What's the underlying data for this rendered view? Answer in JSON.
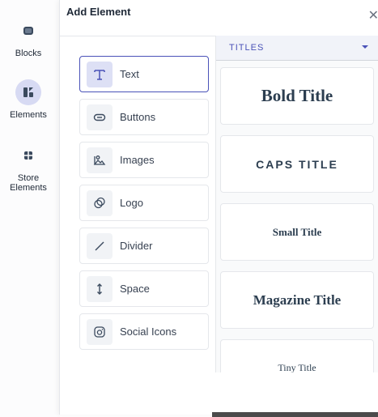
{
  "rail": {
    "items": [
      {
        "label": "Blocks",
        "icon": "blocks-icon"
      },
      {
        "label": "Elements",
        "icon": "elements-icon",
        "active": true
      },
      {
        "label": "Store Elements",
        "icon": "store-elements-icon"
      }
    ]
  },
  "panel": {
    "title": "Add Element",
    "close": "✕"
  },
  "elements": [
    {
      "label": "Text",
      "icon": "text-icon"
    },
    {
      "label": "Buttons",
      "icon": "buttons-icon"
    },
    {
      "label": "Images",
      "icon": "images-icon"
    },
    {
      "label": "Logo",
      "icon": "logo-icon"
    },
    {
      "label": "Divider",
      "icon": "divider-icon"
    },
    {
      "label": "Space",
      "icon": "space-icon"
    },
    {
      "label": "Social Icons",
      "icon": "social-icons-icon"
    }
  ],
  "titles": {
    "category": "TITLES",
    "presets": [
      "Bold Title",
      "CAPS TITLE",
      "Small Title",
      "Magazine Title",
      "Tiny Title"
    ]
  },
  "colors": {
    "accent": "#4a52b8",
    "icon": "#3b4a5e"
  }
}
